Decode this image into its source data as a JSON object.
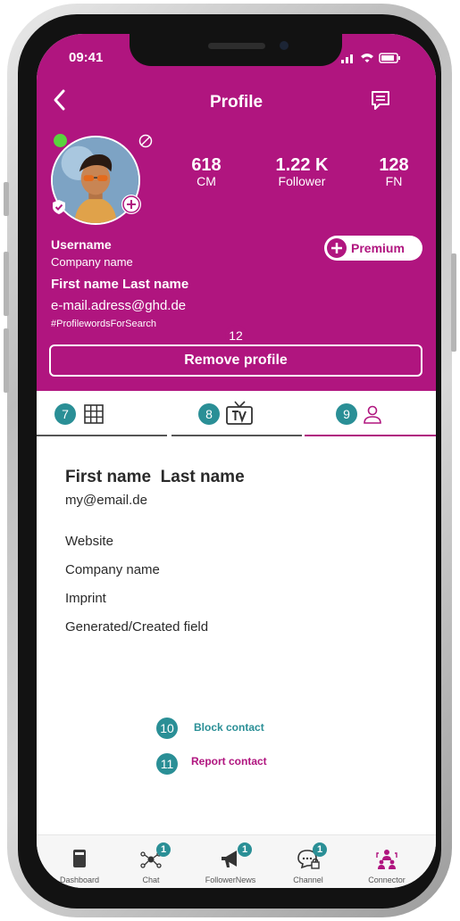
{
  "status_bar": {
    "time": "09:41"
  },
  "header": {
    "title": "Profile"
  },
  "stats": [
    {
      "value": "618",
      "label": "CM"
    },
    {
      "value": "1.22 K",
      "label": "Follower"
    },
    {
      "value": "128",
      "label": "FN"
    }
  ],
  "profile": {
    "username": "Username",
    "company": "Company name",
    "full_name": "First name Last name",
    "email": "e-mail.adress@ghd.de",
    "hashtags": "#ProfilewordsForSearch",
    "premium_label": "Premium",
    "remove_label": "Remove profile"
  },
  "annotations": {
    "n7": "7",
    "n8": "8",
    "n9": "9",
    "n10": "10",
    "n11": "11",
    "n12": "12"
  },
  "contact": {
    "first_name": "First name",
    "last_name": "Last name",
    "email": "my@email.de",
    "fields": [
      "Website",
      "Company name",
      "Imprint",
      "Generated/Created field"
    ],
    "block_label": "Block contact",
    "report_label": "Report contact"
  },
  "bottom_nav": [
    {
      "label": "Dashboard",
      "icon": "dashboard-icon",
      "badge": ""
    },
    {
      "label": "Chat",
      "icon": "chat-network-icon",
      "badge": "1"
    },
    {
      "label": "FollowerNews",
      "icon": "megaphone-icon",
      "badge": "1"
    },
    {
      "label": "Channel",
      "icon": "channel-chat-icon",
      "badge": "1"
    },
    {
      "label": "Connector",
      "icon": "connector-icon",
      "badge": ""
    }
  ],
  "colors": {
    "brand": "#b0157f",
    "teal": "#2a8f96",
    "online": "#59d33d"
  }
}
